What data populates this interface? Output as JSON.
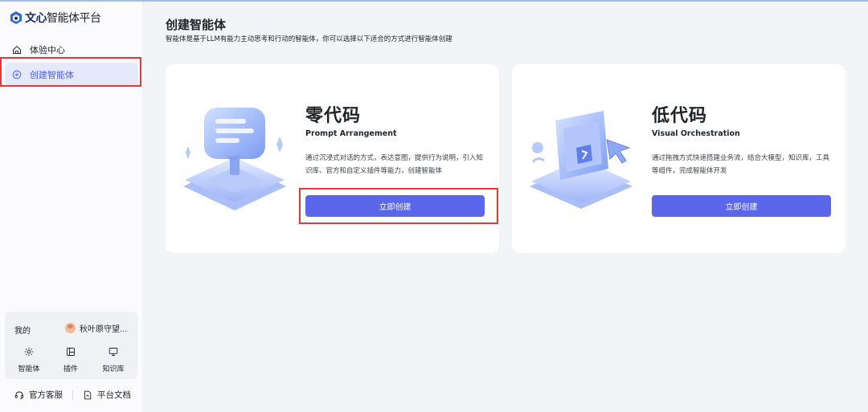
{
  "brand": {
    "strong": "文心",
    "rest": "智能体平台",
    "color": "#1d2c6b"
  },
  "sidebar": {
    "items": [
      {
        "label": "体验中心",
        "icon": "home-icon",
        "active": false
      },
      {
        "label": "创建智能体",
        "icon": "plus-circle-icon",
        "active": true
      }
    ],
    "my": {
      "label": "我的",
      "username": "秋叶原守望...",
      "shortcuts": [
        {
          "label": "智能体",
          "icon": "sparkle-icon"
        },
        {
          "label": "插件",
          "icon": "plugin-icon"
        },
        {
          "label": "知识库",
          "icon": "monitor-icon"
        }
      ]
    },
    "footer": [
      {
        "label": "官方客服",
        "icon": "headset-icon"
      },
      {
        "label": "平台文档",
        "icon": "document-icon"
      }
    ]
  },
  "main": {
    "title": "创建智能体",
    "subtitle": "智能体是基于LLM有能力主动思考和行动的智能体，你可以选择以下适合的方式进行智能体创建",
    "cards": [
      {
        "title": "零代码",
        "subtitle": "Prompt Arrangement",
        "description": "通过沉浸式对话的方式，表达意图，提供行为说明，引入知识库、官方和自定义插件等能力，创建智能体",
        "button": "立即创建",
        "illustration": "chat-bubble-illustration"
      },
      {
        "title": "低代码",
        "subtitle": "Visual Orchestration",
        "description": "通过拖拽方式快速搭建业务流，结合大模型，知识库，工具等组件，完成智能体开发",
        "button": "立即创建",
        "illustration": "cursor-screen-illustration"
      }
    ]
  },
  "colors": {
    "accent": "#5a67ea",
    "highlight": "#e03a3a",
    "active_bg": "#e6e9fc"
  }
}
